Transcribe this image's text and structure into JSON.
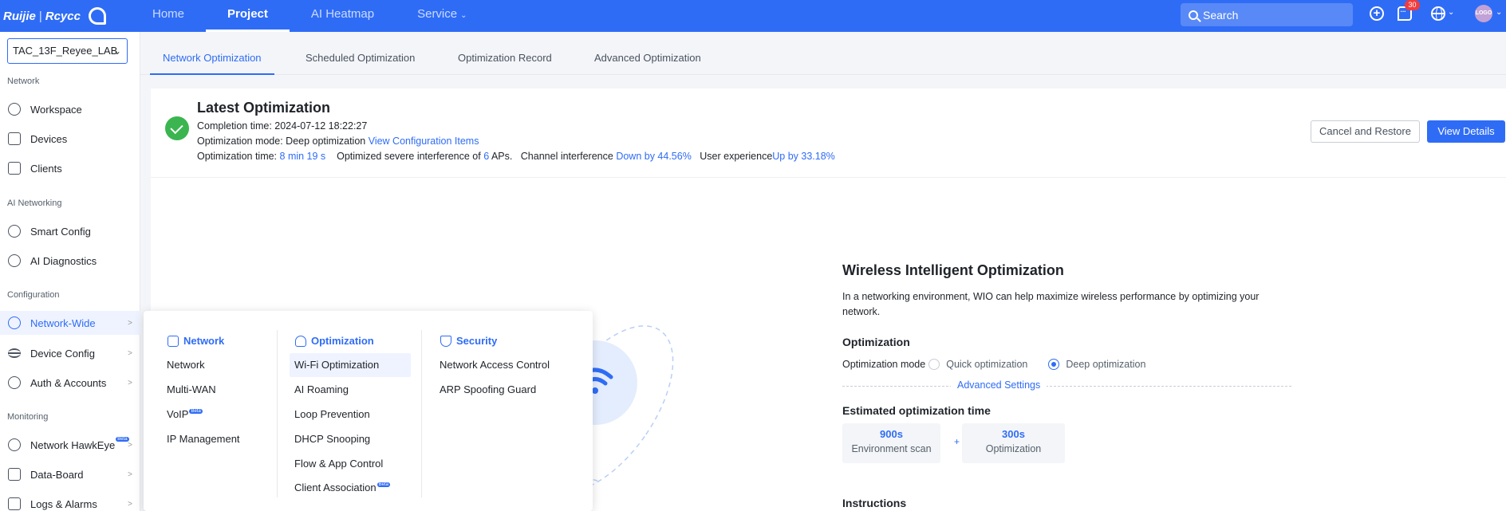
{
  "topbar": {
    "logo_brand": "Ruijie",
    "logo_sep": "|",
    "logo_sub": "Rcycc",
    "nav": [
      {
        "label": "Home"
      },
      {
        "label": "Project"
      },
      {
        "label": "AI Heatmap"
      },
      {
        "label": "Service"
      }
    ],
    "active_nav": "Project",
    "search_placeholder": "Search",
    "notification_count": "30",
    "avatar_text": "LOGO"
  },
  "sidebar": {
    "project": "TAC_13F_Reyee_LAB",
    "groups": {
      "network": "Network",
      "ai_networking": "AI Networking",
      "configuration": "Configuration",
      "monitoring": "Monitoring"
    },
    "items": {
      "workspace": "Workspace",
      "devices": "Devices",
      "clients": "Clients",
      "smart_config": "Smart Config",
      "ai_diagnostics": "AI Diagnostics",
      "network_wide": "Network-Wide",
      "device_config": "Device Config",
      "auth_accounts": "Auth & Accounts",
      "network_hawkeye": "Network HawkEye",
      "data_board": "Data-Board",
      "logs_alarms": "Logs & Alarms"
    },
    "beta_label": "Beta"
  },
  "tabs": [
    "Network Optimization",
    "Scheduled Optimization",
    "Optimization Record",
    "Advanced Optimization"
  ],
  "latest": {
    "title": "Latest Optimization",
    "completion_label": "Completion time: ",
    "completion_time": "2024-07-12 18:22:27",
    "mode_label": "Optimization mode: ",
    "mode_value": "Deep optimization",
    "view_config": "View Configuration Items",
    "time_label": "Optimization time: ",
    "time_value": "8 min 19 s",
    "severe_prefix": "Optimized severe interference of ",
    "severe_count": "6",
    "severe_suffix": " APs.",
    "channel_label": "Channel interference ",
    "channel_value": "Down by 44.56%",
    "ux_label": "User experience",
    "ux_value": "Up by 33.18%",
    "cancel_button": "Cancel and Restore",
    "view_button": "View Details"
  },
  "wio": {
    "title": "Wireless Intelligent Optimization",
    "description": "In a networking environment, WIO can help maximize wireless performance by optimizing your network.",
    "optimization_title": "Optimization",
    "mode_label": "Optimization mode",
    "quick": "Quick optimization",
    "deep": "Deep optimization",
    "advanced_settings": "Advanced Settings",
    "estimated_title": "Estimated optimization time",
    "env_value": "900s",
    "env_label": "Environment scan",
    "plus": "+",
    "opt_value": "300s",
    "opt_label": "Optimization",
    "instructions_title": "Instructions"
  },
  "menu": {
    "network_title": "Network",
    "optimization_title": "Optimization",
    "security_title": "Security",
    "network_items": [
      "Network",
      "Multi-WAN",
      "VoIP",
      "IP Management"
    ],
    "optimization_items": [
      "Wi-Fi Optimization",
      "AI Roaming",
      "Loop Prevention",
      "DHCP Snooping",
      "Flow & App Control",
      "Client Association"
    ],
    "security_items": [
      "Network Access Control",
      "ARP Spoofing Guard"
    ]
  },
  "colors": {
    "primary": "#2f6cf6",
    "success": "#3bb550",
    "badge": "#f23c3c"
  }
}
